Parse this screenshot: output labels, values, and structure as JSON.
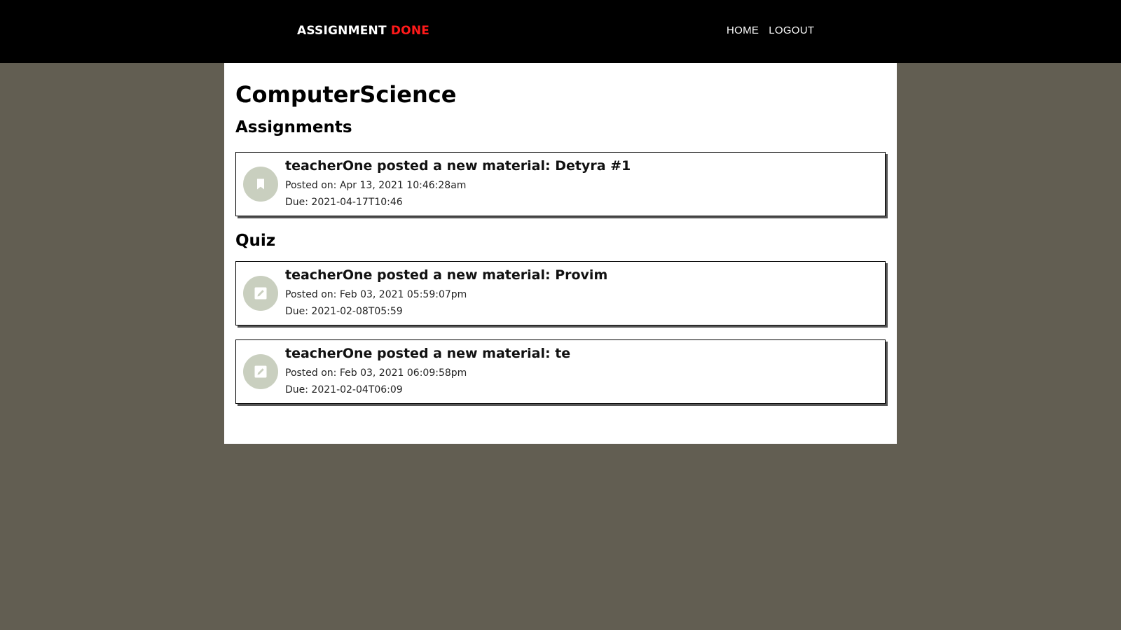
{
  "header": {
    "brand_main": "ASSIGNMENT",
    "brand_accent": "DONE",
    "nav": [
      {
        "label": "HOME"
      },
      {
        "label": "LOGOUT"
      }
    ]
  },
  "main": {
    "title": "ComputerScience",
    "sections": [
      {
        "heading": "Assignments",
        "items": [
          {
            "icon": "bookmark-icon",
            "title": "teacherOne posted a new material: Detyra #1",
            "posted": "Posted on: Apr 13, 2021 10:46:28am",
            "due": "Due: 2021-04-17T10:46"
          }
        ]
      },
      {
        "heading": "Quiz",
        "items": [
          {
            "icon": "edit-icon",
            "title": "teacherOne posted a new material: Provim",
            "posted": "Posted on: Feb 03, 2021 05:59:07pm",
            "due": "Due: 2021-02-08T05:59"
          },
          {
            "icon": "edit-icon",
            "title": "teacherOne posted a new material: te",
            "posted": "Posted on: Feb 03, 2021 06:09:58pm",
            "due": "Due: 2021-02-04T06:09"
          }
        ]
      }
    ]
  },
  "colors": {
    "background": "#625e52",
    "header": "#000000",
    "accent": "#ff1a1a",
    "icon_circle": "#c9cfbf",
    "progress": "#1e6fd0"
  },
  "loading_progress": 0.2
}
